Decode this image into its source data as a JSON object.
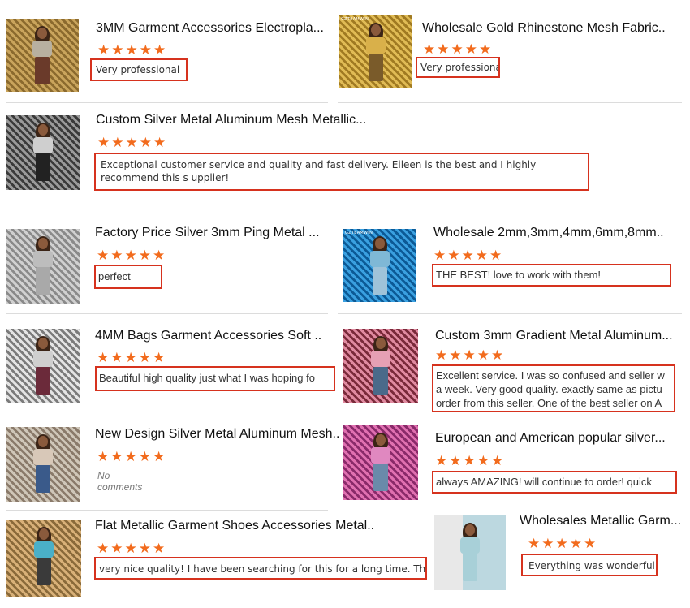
{
  "colors": {
    "star": "#f26b1d",
    "highlight_border": "#d6321e"
  },
  "star_glyphs": "★★★★★",
  "reviews": [
    {
      "title": "3MM Garment Accessories Electropla...",
      "rating": 5,
      "comment": "Very professional"
    },
    {
      "title": "Wholesale Gold Rhinestone Mesh Fabric...",
      "rating": 5,
      "comment": "Very professional"
    },
    {
      "title": "Custom Silver Metal Aluminum Mesh Metallic...",
      "rating": 5,
      "comment": "Exceptional customer service and quality and fast delivery. Eileen is the best and I highly recommend this s upplier!"
    },
    {
      "title": "Factory Price Silver 3mm Ping Metal ...",
      "rating": 5,
      "comment": "perfect"
    },
    {
      "title": "Wholesale 2mm,3mm,4mm,6mm,8mm..",
      "rating": 5,
      "comment": "THE BEST! love to work with them!"
    },
    {
      "title": "4MM Bags Garment Accessories Soft ..",
      "rating": 5,
      "comment": "Beautiful high quality just what I was hoping fo"
    },
    {
      "title": "Custom 3mm Gradient Metal Aluminum...",
      "rating": 5,
      "comment": "Excellent service. I was so confused and seller w a week. Very good quality. exactly same as pictu order from this seller. One of the best seller on A"
    },
    {
      "title": "New Design Silver Metal Aluminum Mesh...",
      "rating": 5,
      "comment": "No comments"
    },
    {
      "title": "European and American popular silver...",
      "rating": 5,
      "comment": "always AMAZING! will continue to order! quick"
    },
    {
      "title": "Flat Metallic Garment Shoes Accessories Metal...",
      "rating": 5,
      "comment": "very nice quality! I have been searching for this for a long time. Thank you!"
    },
    {
      "title": "Wholesales Metallic Garm...",
      "rating": 5,
      "comment": "Everything was wonderful!"
    }
  ]
}
